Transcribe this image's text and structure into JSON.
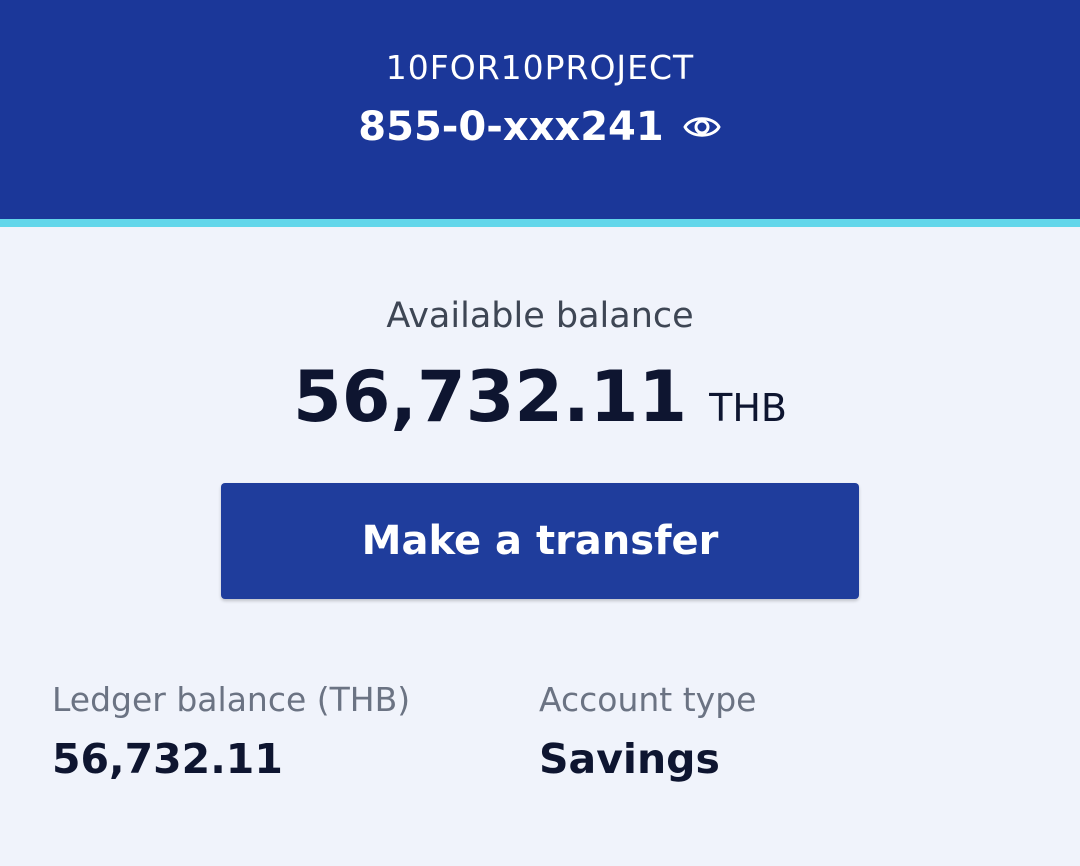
{
  "header": {
    "account_name": "10FOR10PROJECT",
    "account_number": "855-0-xxx241",
    "reveal_icon": "eye-icon"
  },
  "balance": {
    "label": "Available balance",
    "amount": "56,732.11",
    "currency": "THB"
  },
  "actions": {
    "transfer_label": "Make a transfer"
  },
  "details": {
    "ledger_label": "Ledger balance (THB)",
    "ledger_value": "56,732.11",
    "type_label": "Account type",
    "type_value": "Savings"
  },
  "colors": {
    "header_bg": "#1b3799",
    "accent": "#62d6ea",
    "button_bg": "#1f3d9c",
    "page_bg": "#f0f3fb"
  }
}
